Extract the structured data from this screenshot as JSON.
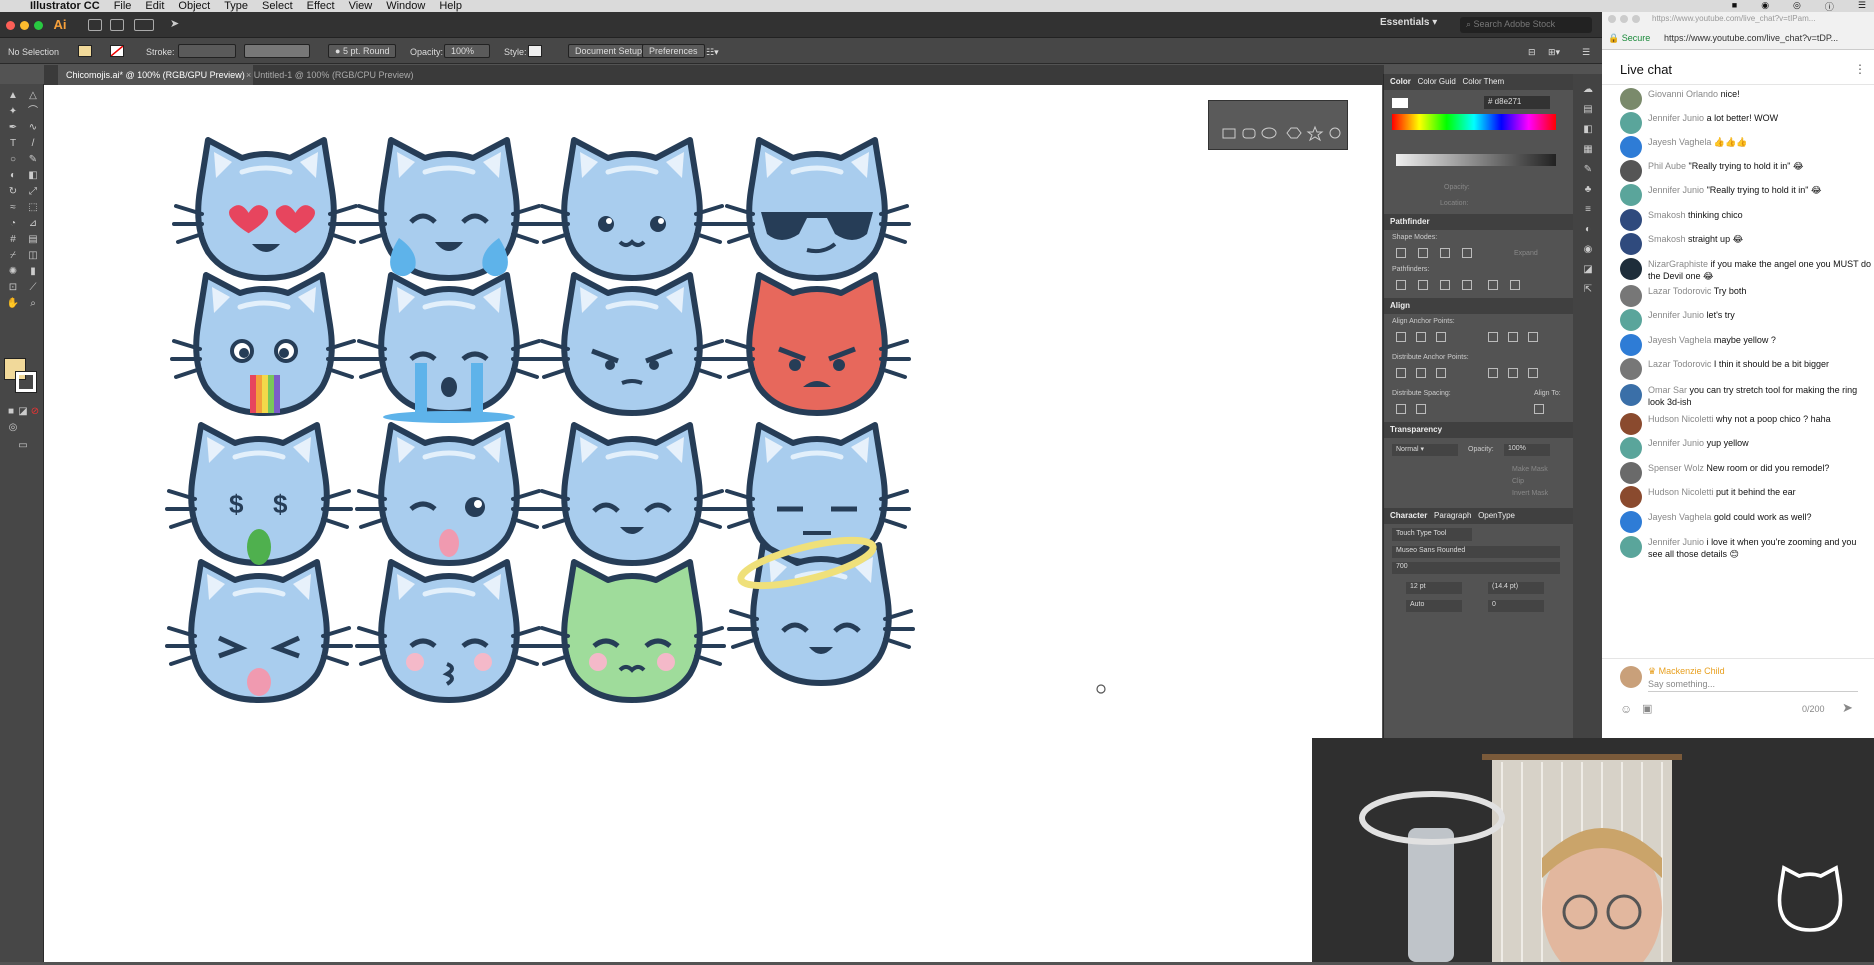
{
  "menubar": {
    "app": "Illustrator CC",
    "items": [
      "File",
      "Edit",
      "Object",
      "Type",
      "Select",
      "Effect",
      "View",
      "Window",
      "Help"
    ]
  },
  "appbar": {
    "workspace": "Essentials",
    "search_placeholder": "Search Adobe Stock"
  },
  "control": {
    "selection": "No Selection",
    "stroke_label": "Stroke:",
    "brush": "5 pt. Round",
    "opacity_label": "Opacity:",
    "opacity": "100%",
    "style_label": "Style:",
    "doc_setup": "Document Setup",
    "preferences": "Preferences",
    "fill_color": "#f1d99a"
  },
  "tabs": [
    {
      "label": "Chicomojis.ai* @ 100% (RGB/GPU Preview)"
    },
    {
      "label": "Untitled-1 @ 100% (RGB/CPU Preview)"
    }
  ],
  "panels": {
    "color_tabs": [
      "Color",
      "Color Guid",
      "Color Them"
    ],
    "hex": "d8e271",
    "opacity_label": "Opacity:",
    "location_label": "Location:",
    "pathfinder": "Pathfinder",
    "shape_modes": "Shape Modes:",
    "expand": "Expand",
    "pathfinders": "Pathfinders:",
    "align": "Align",
    "align_anchor": "Align Anchor Points:",
    "distribute_anchor": "Distribute Anchor Points:",
    "distribute_spacing": "Distribute Spacing:",
    "align_to": "Align To:",
    "transparency": "Transparency",
    "blend": "Normal",
    "t_opacity_label": "Opacity:",
    "t_opacity": "100%",
    "make_mask": "Make Mask",
    "clip": "Clip",
    "invert": "Invert Mask",
    "char_tabs": [
      "Character",
      "Paragraph",
      "OpenType"
    ],
    "touch_type": "Touch Type Tool",
    "font": "Museo Sans Rounded",
    "weight": "700",
    "size": "12 pt",
    "leading": "(14.4 pt)",
    "kerning": "Auto",
    "tracking": "0"
  },
  "browser": {
    "url_bar": "https://www.youtube.com/live_chat?v=tIPam...",
    "secure": "Secure",
    "url": "https://www.youtube.com/live_chat?v=tDP...",
    "chat_title": "Live chat",
    "messages": [
      {
        "author": "Giovanni Orlando",
        "text": "nice!",
        "color": "#7a8a6b"
      },
      {
        "author": "Jennifer Junio",
        "text": "a lot better! WOW",
        "color": "#5aa59b"
      },
      {
        "author": "Jayesh Vaghela",
        "text": "👍👍👍",
        "color": "#2e7cd6"
      },
      {
        "author": "Phil Aube",
        "text": "\"Really trying to hold it in\" 😂",
        "color": "#555"
      },
      {
        "author": "Jennifer Junio",
        "text": "\"Really trying to hold it in\" 😂",
        "color": "#5aa59b"
      },
      {
        "author": "Smakosh",
        "text": "thinking chico",
        "color": "#2f4a7d"
      },
      {
        "author": "Smakosh",
        "text": "straight up 😂",
        "color": "#2f4a7d"
      },
      {
        "author": "NizarGraphiste",
        "text": "if you make the angel one you MUST do the Devil one 😂",
        "color": "#1e2d3a"
      },
      {
        "author": "Lazar Todorovic",
        "text": "Try both",
        "color": "#777"
      },
      {
        "author": "Jennifer Junio",
        "text": "let's try",
        "color": "#5aa59b"
      },
      {
        "author": "Jayesh Vaghela",
        "text": "maybe yellow ?",
        "color": "#2e7cd6"
      },
      {
        "author": "Lazar Todorovic",
        "text": "I thin it should be a bit bigger",
        "color": "#777"
      },
      {
        "author": "Omar Sar",
        "text": "you can try stretch tool for making the ring look 3d-ish",
        "color": "#3a6fa8"
      },
      {
        "author": "Hudson Nicoletti",
        "text": "why not a poop chico ? haha",
        "color": "#8a4a2e"
      },
      {
        "author": "Jennifer Junio",
        "text": "yup yellow",
        "color": "#5aa59b"
      },
      {
        "author": "Spenser Wolz",
        "text": "New room or did you remodel?",
        "color": "#6a6a6a"
      },
      {
        "author": "Hudson Nicoletti",
        "text": "put it behind the ear",
        "color": "#8a4a2e"
      },
      {
        "author": "Jayesh Vaghela",
        "text": "gold could work as well?",
        "color": "#2e7cd6"
      },
      {
        "author": "Jennifer Junio",
        "text": "i love it when you're zooming and you see all those details 😊",
        "color": "#5aa59b"
      }
    ],
    "input_author": "Mackenzie Child",
    "input_placeholder": "Say something...",
    "counter": "0/200"
  },
  "colors": {
    "cat_blue": "#a9cdee",
    "outline": "#263d57",
    "red_cat": "#e7685c",
    "green_cat": "#9fdc9b",
    "halo": "#efe07a"
  }
}
